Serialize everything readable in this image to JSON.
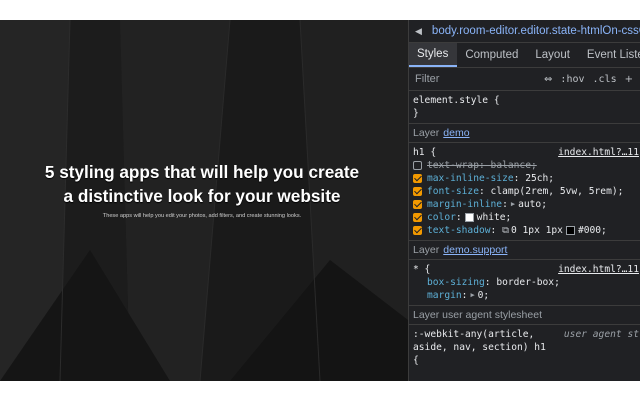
{
  "preview": {
    "title": "5 styling apps that will help you create a distinctive look for your website",
    "subtitle": "These apps will help you edit your photos, add filters, and create stunning looks."
  },
  "devtools": {
    "breadcrumb": "body.room-editor.editor.state-htmlOn-cssOn",
    "tabs": [
      "Styles",
      "Computed",
      "Layout",
      "Event Listeners"
    ],
    "active_tab": "Styles",
    "filter_placeholder": "Filter",
    "toolbar": {
      "hov": ":hov",
      "cls": ".cls"
    },
    "element_style": {
      "selector": "element.style {",
      "close": "}"
    },
    "layer_label": "Layer",
    "layer_demo": "demo",
    "h1_rule": {
      "selector": "h1 {",
      "source": "index.html?…11",
      "declarations": [
        {
          "prop": "text-wrap",
          "value": "balance;",
          "enabled": false
        },
        {
          "prop": "max-inline-size",
          "value": "25ch;",
          "enabled": true
        },
        {
          "prop": "font-size",
          "value": "clamp(2rem, 5vw, 5rem);",
          "enabled": true
        },
        {
          "prop": "margin-inline",
          "value": "auto;",
          "enabled": true
        },
        {
          "prop": "color",
          "value": "white;",
          "enabled": true
        },
        {
          "prop": "text-shadow",
          "value": "0 1px 1px",
          "value2": "#000;",
          "enabled": true
        }
      ]
    },
    "layer_support": "demo.support",
    "star_rule": {
      "selector": "* {",
      "source": "index.html?…11",
      "declarations": [
        {
          "prop": "box-sizing",
          "value": "border-box;"
        },
        {
          "prop": "margin",
          "value": "0;"
        }
      ]
    },
    "layer_ua": "Layer user agent stylesheet",
    "ua_rule": {
      "selector_line1": ":-webkit-any(article,",
      "selector_line2": "aside, nav, section) h1",
      "selector_line3": "{",
      "source": "user agent st"
    }
  },
  "colors": {
    "devtools_bg": "#202124",
    "accent": "#8ab4f8",
    "checkbox": "#f29900",
    "property": "#5db0d7"
  }
}
